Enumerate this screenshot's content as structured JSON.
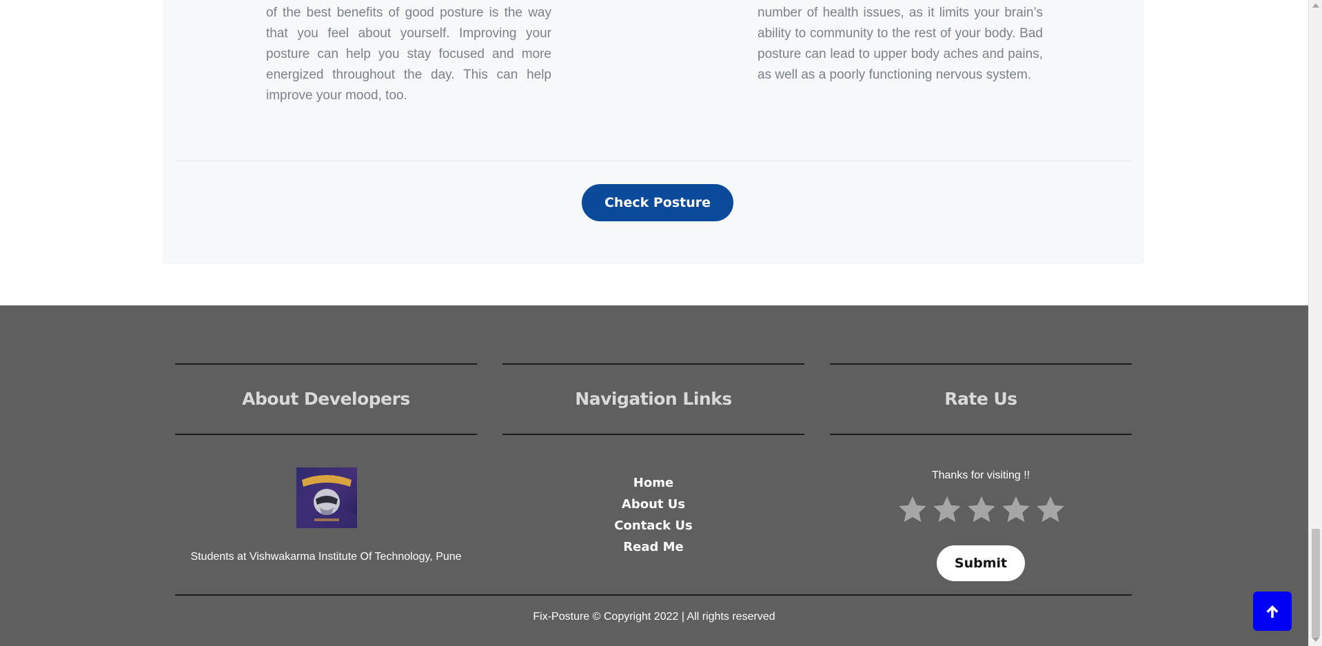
{
  "content": {
    "left_paragraph": "of the best benefits of good posture is the way that you feel about yourself. Improving your posture can help you stay focused and more energized throughout the day. This can help improve your mood, too.",
    "right_paragraph": "number of health issues, as it limits your brain’s ability to community to the rest of your body. Bad posture can lead to upper body aches and pains, as well as a poorly functioning nervous system.",
    "check_button_label": "Check Posture"
  },
  "footer": {
    "about": {
      "title": "About Developers",
      "logo_icon": "team-logo-icon",
      "caption": "Students at Vishwakarma Institute Of Technology, Pune"
    },
    "navigation": {
      "title": "Navigation Links",
      "links": [
        {
          "label": "Home"
        },
        {
          "label": "About Us"
        },
        {
          "label": "Contack Us"
        },
        {
          "label": "Read Me"
        }
      ]
    },
    "rate": {
      "title": "Rate Us",
      "thanks": "Thanks for visiting !!",
      "stars": 5,
      "star_color": "#a6a6a6",
      "submit_label": "Submit"
    },
    "copyright": "Fix-Posture © Copyright 2022 | All rights reserved"
  },
  "colors": {
    "primary_button": "#0a4a9a",
    "footer_bg": "#5f5f5f",
    "back_to_top": "#0000f5"
  },
  "back_to_top": {
    "icon": "arrow-up-icon"
  }
}
